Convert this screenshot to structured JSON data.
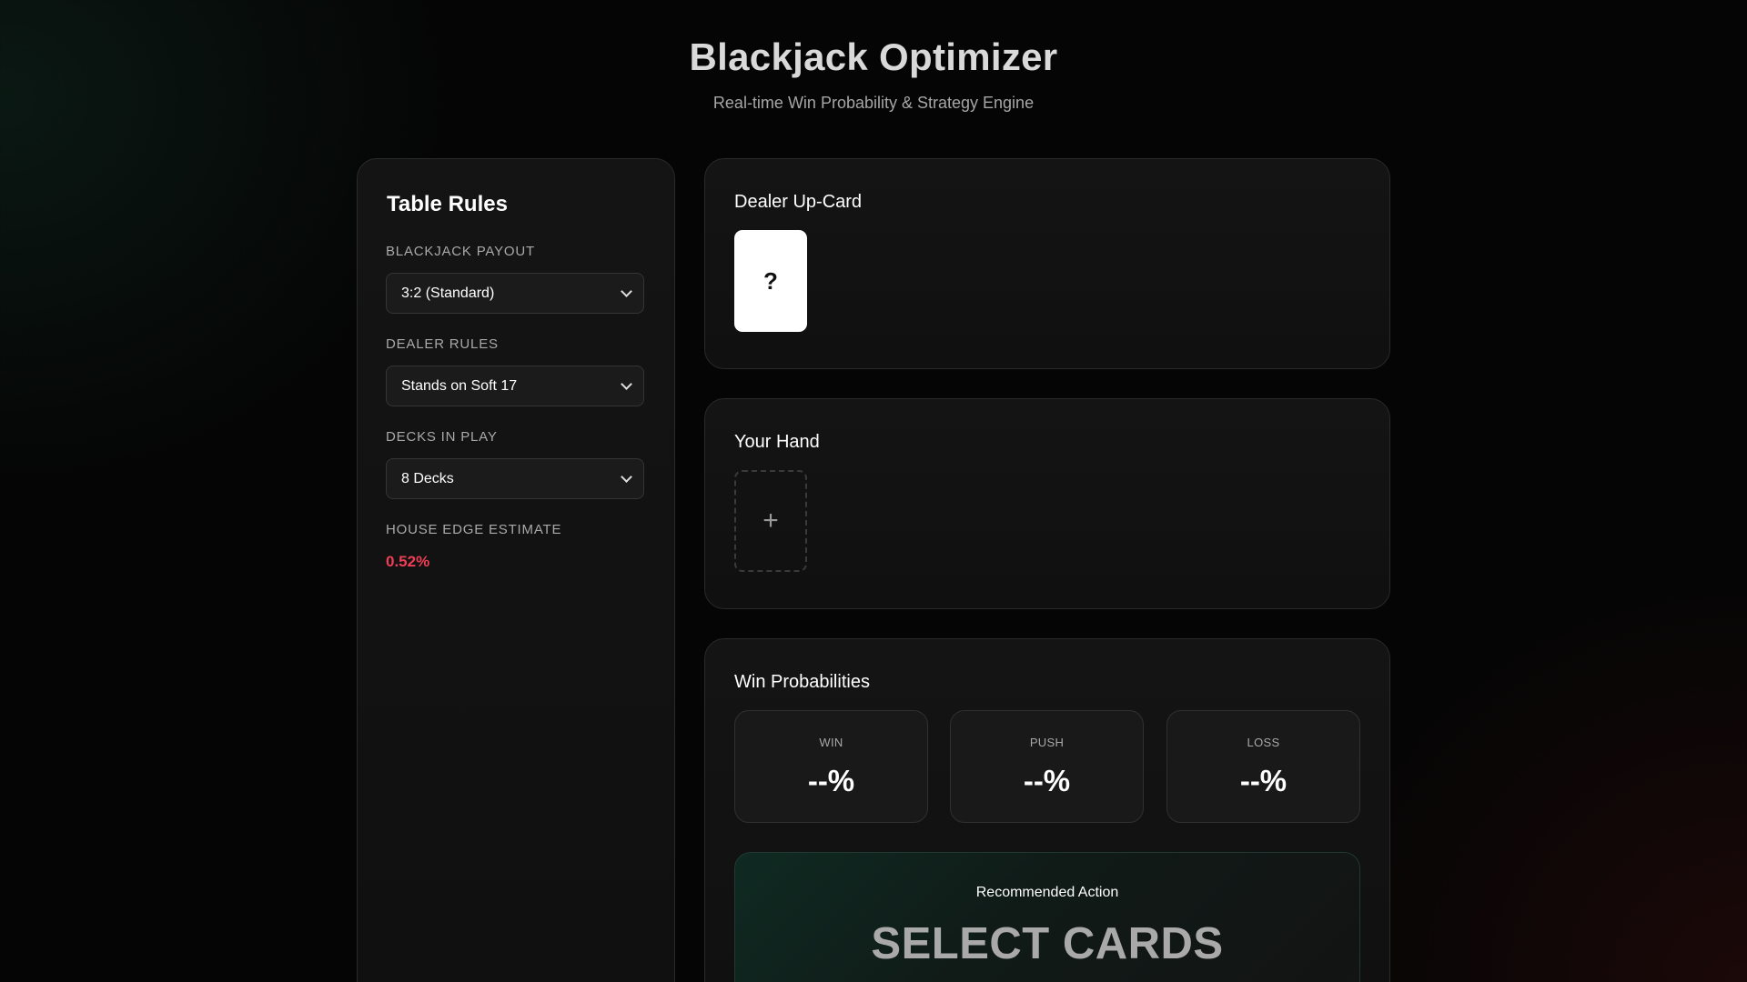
{
  "header": {
    "title": "Blackjack Optimizer",
    "subtitle": "Real-time Win Probability & Strategy Engine"
  },
  "rules": {
    "title": "Table Rules",
    "payout": {
      "label": "Blackjack Payout",
      "selected": "3:2 (Standard)"
    },
    "dealer": {
      "label": "Dealer Rules",
      "selected": "Stands on Soft 17"
    },
    "decks": {
      "label": "Decks in Play",
      "selected": "8 Decks"
    },
    "house_edge": {
      "label": "House Edge Estimate",
      "value": "0.52%"
    }
  },
  "dealer_card": {
    "title": "Dealer Up-Card",
    "card": "?"
  },
  "hand": {
    "title": "Your Hand",
    "add_glyph": "+"
  },
  "probabilities": {
    "title": "Win Probabilities",
    "win": {
      "label": "WIN",
      "value": "--%"
    },
    "push": {
      "label": "PUSH",
      "value": "--%"
    },
    "loss": {
      "label": "LOSS",
      "value": "--%"
    }
  },
  "recommendation": {
    "label": "Recommended Action",
    "value": "SELECT CARDS"
  },
  "colors": {
    "accent_negative": "#ef3e56",
    "background": "#050505",
    "panel": "#141414"
  }
}
